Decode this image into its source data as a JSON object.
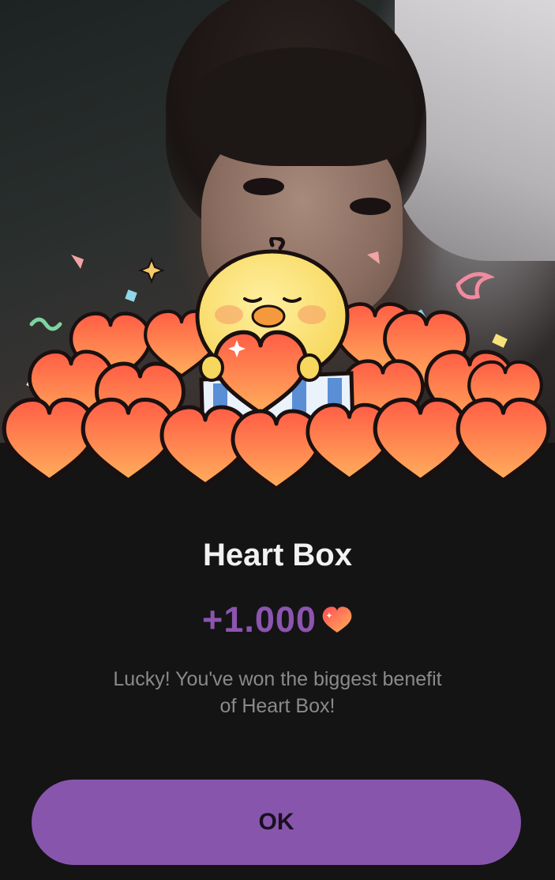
{
  "dialog": {
    "title": "Heart Box",
    "amount": "+1.000",
    "amount_icon": "heart-icon",
    "description_line1": "Lucky! You've won the biggest benefit",
    "description_line2": "of Heart Box!",
    "ok_label": "OK"
  },
  "illustration": {
    "name": "chick-in-heart-box",
    "icons": [
      "chick-icon",
      "heart-icon",
      "gift-box-icon",
      "confetti-icon",
      "sparkle-icon"
    ]
  },
  "colors": {
    "background": "#141414",
    "title": "#f2f2f2",
    "accent_purple": "#8855ad",
    "amount": "#8c55b0",
    "description": "#8a8a8a",
    "heart_top": "#ff6a48",
    "heart_bottom": "#ffab5a",
    "chick": "#fde27a"
  }
}
